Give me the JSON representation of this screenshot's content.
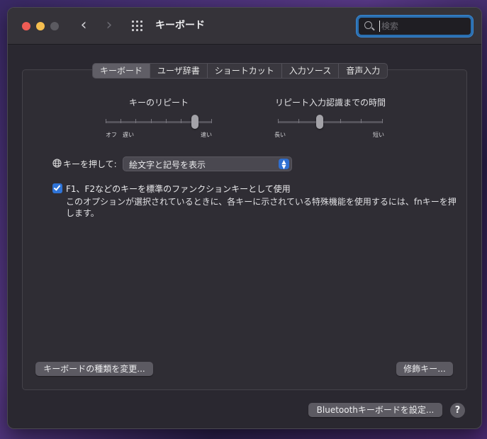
{
  "window": {
    "title": "キーボード"
  },
  "search": {
    "placeholder": "検索",
    "value": ""
  },
  "tabs": [
    {
      "label": "キーボード",
      "active": true
    },
    {
      "label": "ユーザ辞書",
      "active": false
    },
    {
      "label": "ショートカット",
      "active": false
    },
    {
      "label": "入力ソース",
      "active": false
    },
    {
      "label": "音声入力",
      "active": false
    }
  ],
  "key_repeat": {
    "title": "キーのリピート",
    "left_label_1": "オフ",
    "left_label_2": "遅い",
    "right_label": "速い",
    "ticks": 8,
    "selected_index": 6
  },
  "repeat_delay": {
    "title": "リピート入力認識までの時間",
    "left_label": "長い",
    "right_label": "短い",
    "ticks": 6,
    "selected_index": 2
  },
  "globe_key": {
    "label": "キーを押して:",
    "selected_option": "絵文字と記号を表示"
  },
  "fn_keys": {
    "checked": true,
    "label": "F1、F2などのキーを標準のファンクションキーとして使用",
    "description": "このオプションが選択されているときに、各キーに示されている特殊機能を使用するには、fnキーを押します。"
  },
  "buttons": {
    "change_type": "キーボードの種類を変更...",
    "modifier_keys": "修飾キー...",
    "bluetooth_setup": "Bluetoothキーボードを設定...",
    "help": "?"
  },
  "colors": {
    "accent": "#2f74d8",
    "close": "#ee5c55",
    "minimize": "#f5be4f"
  }
}
